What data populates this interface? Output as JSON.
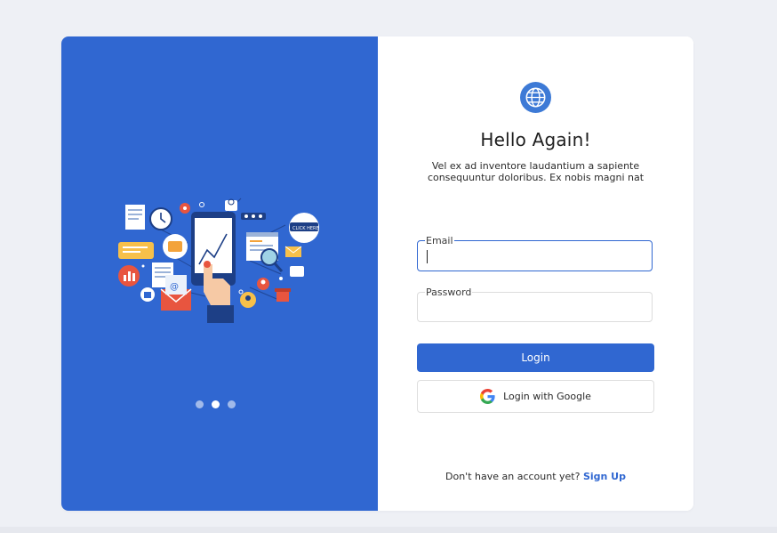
{
  "colors": {
    "brand": "#3067d1",
    "page_bg": "#eef0f5",
    "card_bg": "#ffffff"
  },
  "hero": {
    "illustration": "digital-marketing-illustration",
    "badge_text": "CLICK HERE",
    "carousel": {
      "count": 3,
      "active_index": 1
    }
  },
  "form": {
    "logo_icon": "globe-icon",
    "title": "Hello Again!",
    "subtitle": "Vel ex ad inventore laudantium a sapiente consequuntur doloribus. Ex nobis magni nat",
    "email": {
      "label": "Email",
      "value": ""
    },
    "password": {
      "label": "Password",
      "value": ""
    },
    "login_label": "Login",
    "google_label": "Login with Google",
    "google_icon": "google-icon",
    "signup_prompt": "Don't have an account yet?",
    "signup_link": "Sign Up"
  }
}
